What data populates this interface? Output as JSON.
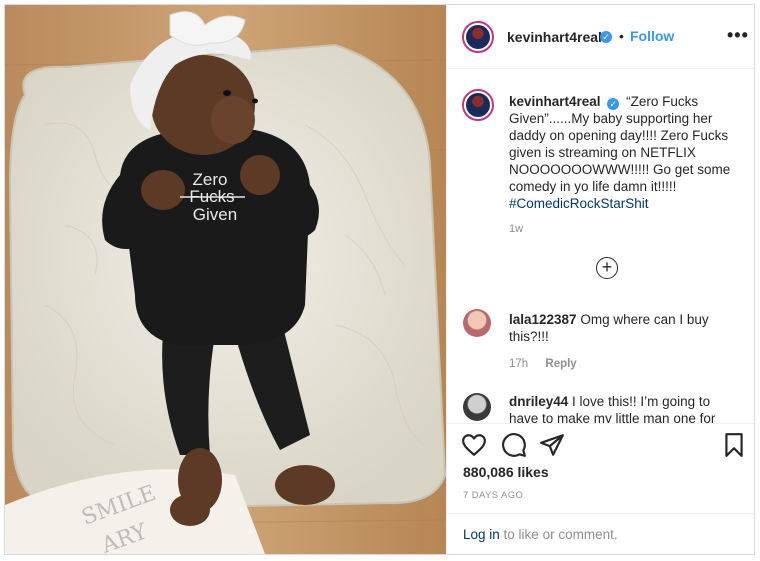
{
  "post": {
    "username": "kevinhart4real",
    "follow_label": "Follow",
    "dot_separator": "•",
    "more_label": "•••",
    "caption_text": "“Zero Fucks Given”......My baby supporting her daddy on opening day!!!! Zero Fucks given is streaming on NETFLIX NOOOOOOOWWW!!!!! Go get some comedy in yo life damn it!!!!!",
    "hashtag": "#ComedicRockStarShit",
    "caption_age": "1w",
    "load_more_icon": "plus-circle-icon",
    "shirt_text": [
      "Zero",
      "Fucks",
      "Given"
    ]
  },
  "comments": [
    {
      "username": "lala122387",
      "text": "Omg where can I buy this?!!!",
      "age": "17h",
      "reply_label": "Reply"
    },
    {
      "username": "dnriley44",
      "text": "I love this!! I’m going to have to make my little man one for when he"
    }
  ],
  "actions": {
    "icons": [
      "heart-icon",
      "comment-icon",
      "share-icon",
      "bookmark-icon"
    ],
    "likes": "880,086 likes",
    "date": "7 DAYS AGO"
  },
  "login": {
    "link": "Log in",
    "rest": " to like or comment."
  },
  "colors": {
    "accent": "#3897f0",
    "hashtag": "#00376b",
    "muted": "#8e8e8e"
  }
}
